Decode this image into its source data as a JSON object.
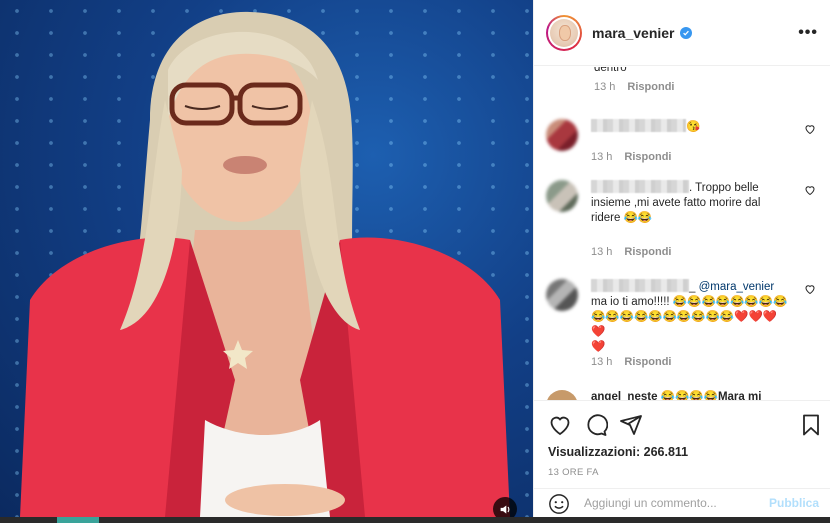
{
  "post": {
    "username": "mara_venier",
    "verified": true,
    "more_label": "•••"
  },
  "comments": [
    {
      "id": "c0",
      "text": "dentro",
      "time": "13 h",
      "reply": "Rispondi"
    },
    {
      "id": "c1",
      "name_hidden": true,
      "text": "😘",
      "time": "13 h",
      "reply": "Rispondi"
    },
    {
      "id": "c2",
      "name_hidden": true,
      "text_line1": ". Troppo belle",
      "text_line2": "insieme ,mi avete fatto morire dal",
      "text_line3": "ridere 😂😂",
      "time": "13 h",
      "reply": "Rispondi"
    },
    {
      "id": "c3",
      "name_hidden": true,
      "mention": "@mara_venier",
      "text_line1": "ma io ti amo!!!!! 😂😂😂😂😂😂😂😂",
      "text_line2": "😂😂😂😂😂😂😂😂😂😂❤️❤️❤️❤️",
      "text_line3": "❤️",
      "time": "13 h",
      "reply": "Rispondi"
    },
    {
      "id": "c4",
      "partial_text": "angel_neste 😂😂😂😂Mara mi"
    }
  ],
  "stats": {
    "views_label": "Visualizzazioni:",
    "views_value": "266.811",
    "posted": "13 ORE FA"
  },
  "composer": {
    "placeholder": "Aggiungi un commento...",
    "publish": "Pubblica"
  },
  "colors": {
    "accent": "#3897f0",
    "publish_disabled": "#b2dffc",
    "muted": "#8e8e8e",
    "jacket": "#e8334a"
  },
  "icons": [
    "mute-icon",
    "verified-icon",
    "more-icon",
    "heart-icon",
    "comment-icon",
    "share-icon",
    "bookmark-icon",
    "emoji-icon"
  ]
}
